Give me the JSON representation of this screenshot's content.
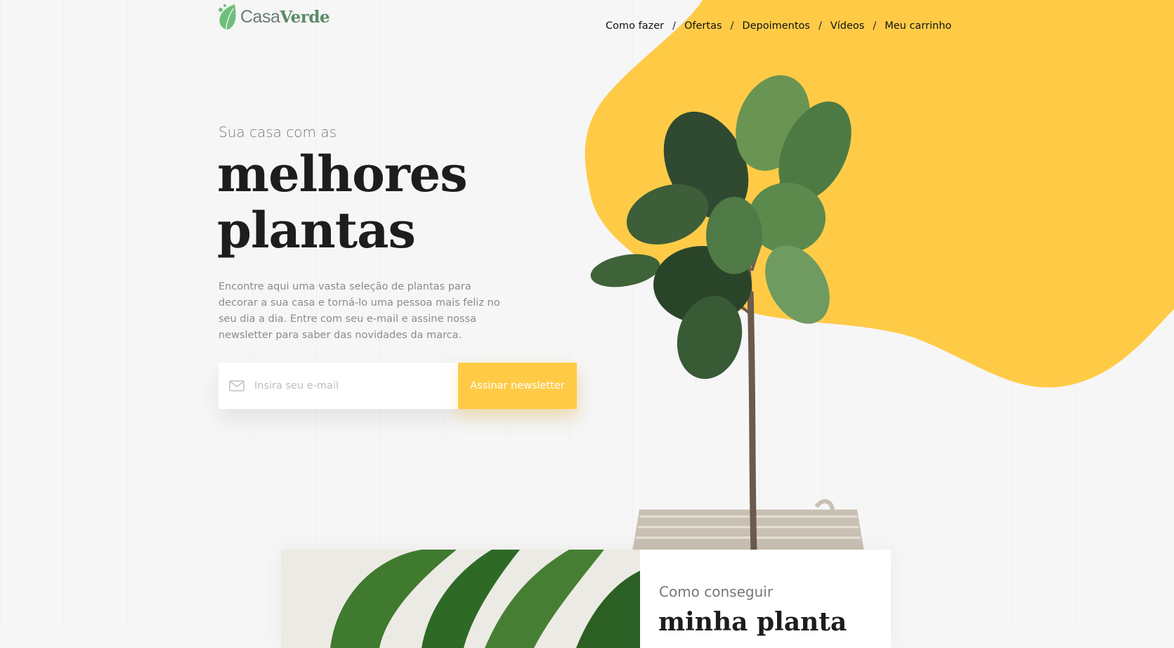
{
  "brand": {
    "name_light": "Casa",
    "name_bold": "Verde",
    "icon": "leaf-logo-icon",
    "accent": "#5a8a64"
  },
  "nav": {
    "items": [
      {
        "label": "Como fazer"
      },
      {
        "label": "Ofertas"
      },
      {
        "label": "Depoimentos"
      },
      {
        "label": "Vídeos"
      },
      {
        "label": "Meu carrinho"
      }
    ],
    "separator": "/"
  },
  "hero": {
    "kicker": "Sua casa com as",
    "title_line1": "melhores",
    "title_line2": "plantas",
    "description": "Encontre aqui uma vasta seleção de plantas para decorar a sua casa e torná-lo uma pessoa mais feliz no seu dia a dia. Entre com seu e-mail e assine nossa newsletter para saber das novidades da marca.",
    "accent_color": "#ffcb47"
  },
  "newsletter": {
    "icon": "mail-icon",
    "placeholder": "Insira seu e-mail",
    "value": "",
    "button_label": "Assinar newsletter"
  },
  "feature": {
    "kicker": "Como conseguir",
    "title": "minha planta"
  }
}
